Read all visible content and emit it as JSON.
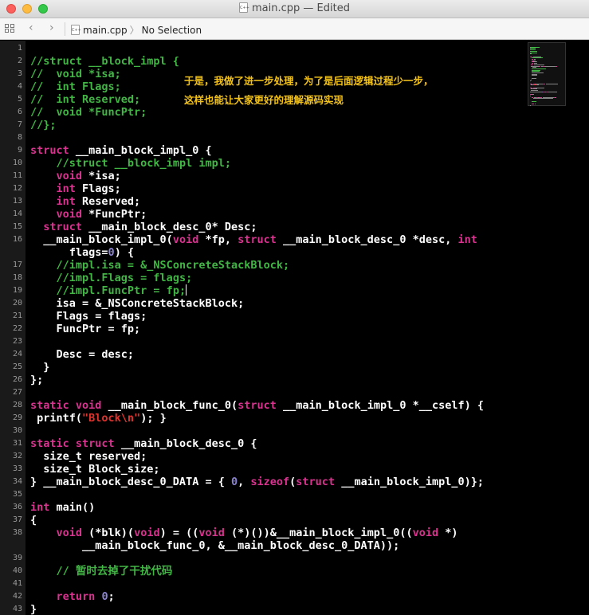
{
  "window": {
    "title": "main.cpp — Edited",
    "colors": {
      "close": "#fc605c",
      "minimize": "#fdbc40",
      "maximize": "#34c84a"
    }
  },
  "navbar": {
    "breadcrumb_file": "main.cpp",
    "breadcrumb_separator": "〉",
    "breadcrumb_selection": "No Selection",
    "back_icon": "‹",
    "forward_icon": "›"
  },
  "annotations": {
    "line1": "于是，我做了进一步处理，为了是后面逻辑过程少一步，",
    "line2": "这样也能让大家更好的理解源码实现"
  },
  "syntax_colors": {
    "comment": "#41b645",
    "keyword": "#d7338f",
    "string": "#e0332e",
    "number": "#8b84cf",
    "plain": "#ffffff"
  },
  "code_lines": [
    {
      "n": "1",
      "tokens": []
    },
    {
      "n": "2",
      "tokens": [
        [
          "c",
          "//struct __block_impl {"
        ]
      ]
    },
    {
      "n": "3",
      "tokens": [
        [
          "c",
          "//  void *isa;"
        ]
      ]
    },
    {
      "n": "4",
      "tokens": [
        [
          "c",
          "//  int Flags;"
        ]
      ]
    },
    {
      "n": "5",
      "tokens": [
        [
          "c",
          "//  int Reserved;"
        ]
      ]
    },
    {
      "n": "6",
      "tokens": [
        [
          "c",
          "//  void *FuncPtr;"
        ]
      ]
    },
    {
      "n": "7",
      "tokens": [
        [
          "c",
          "//};"
        ]
      ]
    },
    {
      "n": "8",
      "tokens": []
    },
    {
      "n": "9",
      "tokens": [
        [
          "k",
          "struct"
        ],
        [
          "p",
          " __main_block_impl_0 {"
        ]
      ]
    },
    {
      "n": "10",
      "tokens": [
        [
          "p",
          "    "
        ],
        [
          "c",
          "//struct __block_impl impl;"
        ]
      ]
    },
    {
      "n": "11",
      "tokens": [
        [
          "p",
          "    "
        ],
        [
          "k",
          "void"
        ],
        [
          "p",
          " *isa;"
        ]
      ]
    },
    {
      "n": "12",
      "tokens": [
        [
          "p",
          "    "
        ],
        [
          "k",
          "int"
        ],
        [
          "p",
          " Flags;"
        ]
      ]
    },
    {
      "n": "13",
      "tokens": [
        [
          "p",
          "    "
        ],
        [
          "k",
          "int"
        ],
        [
          "p",
          " Reserved;"
        ]
      ]
    },
    {
      "n": "14",
      "tokens": [
        [
          "p",
          "    "
        ],
        [
          "k",
          "void"
        ],
        [
          "p",
          " *FuncPtr;"
        ]
      ]
    },
    {
      "n": "15",
      "tokens": [
        [
          "p",
          "  "
        ],
        [
          "k",
          "struct"
        ],
        [
          "p",
          " __main_block_desc_0* Desc;"
        ]
      ]
    },
    {
      "n": "16",
      "tokens": [
        [
          "p",
          "  __main_block_impl_0("
        ],
        [
          "k",
          "void"
        ],
        [
          "p",
          " *fp, "
        ],
        [
          "k",
          "struct"
        ],
        [
          "p",
          " __main_block_desc_0 *desc, "
        ],
        [
          "k",
          "int"
        ]
      ]
    },
    {
      "n": "",
      "tokens": [
        [
          "p",
          "      flags="
        ],
        [
          "n",
          "0"
        ],
        [
          "p",
          ") {"
        ]
      ]
    },
    {
      "n": "17",
      "tokens": [
        [
          "p",
          "    "
        ],
        [
          "c",
          "//impl.isa = &_NSConcreteStackBlock;"
        ]
      ]
    },
    {
      "n": "18",
      "tokens": [
        [
          "p",
          "    "
        ],
        [
          "c",
          "//impl.Flags = flags;"
        ]
      ]
    },
    {
      "n": "19",
      "tokens": [
        [
          "p",
          "    "
        ],
        [
          "c",
          "//impl.FuncPtr = fp;"
        ],
        [
          "cur",
          ""
        ]
      ]
    },
    {
      "n": "20",
      "tokens": [
        [
          "p",
          "    isa = &_NSConcreteStackBlock;"
        ]
      ]
    },
    {
      "n": "21",
      "tokens": [
        [
          "p",
          "    Flags = flags;"
        ]
      ]
    },
    {
      "n": "22",
      "tokens": [
        [
          "p",
          "    FuncPtr = fp;"
        ]
      ]
    },
    {
      "n": "23",
      "tokens": []
    },
    {
      "n": "24",
      "tokens": [
        [
          "p",
          "    Desc = desc;"
        ]
      ]
    },
    {
      "n": "25",
      "tokens": [
        [
          "p",
          "  }"
        ]
      ]
    },
    {
      "n": "26",
      "tokens": [
        [
          "p",
          "};"
        ]
      ]
    },
    {
      "n": "27",
      "tokens": []
    },
    {
      "n": "28",
      "tokens": [
        [
          "k",
          "static"
        ],
        [
          "p",
          " "
        ],
        [
          "k",
          "void"
        ],
        [
          "p",
          " __main_block_func_0("
        ],
        [
          "k",
          "struct"
        ],
        [
          "p",
          " __main_block_impl_0 *__cself) {"
        ]
      ]
    },
    {
      "n": "29",
      "tokens": [
        [
          "p",
          " printf("
        ],
        [
          "s",
          "\"Block\\n\""
        ],
        [
          "p",
          "); }"
        ]
      ]
    },
    {
      "n": "30",
      "tokens": []
    },
    {
      "n": "31",
      "tokens": [
        [
          "k",
          "static"
        ],
        [
          "p",
          " "
        ],
        [
          "k",
          "struct"
        ],
        [
          "p",
          " __main_block_desc_0 {"
        ]
      ]
    },
    {
      "n": "32",
      "tokens": [
        [
          "p",
          "  size_t reserved;"
        ]
      ]
    },
    {
      "n": "33",
      "tokens": [
        [
          "p",
          "  size_t Block_size;"
        ]
      ]
    },
    {
      "n": "34",
      "tokens": [
        [
          "p",
          "} __main_block_desc_0_DATA = { "
        ],
        [
          "n",
          "0"
        ],
        [
          "p",
          ", "
        ],
        [
          "k",
          "sizeof"
        ],
        [
          "p",
          "("
        ],
        [
          "k",
          "struct"
        ],
        [
          "p",
          " __main_block_impl_0)};"
        ]
      ]
    },
    {
      "n": "35",
      "tokens": []
    },
    {
      "n": "36",
      "tokens": [
        [
          "k",
          "int"
        ],
        [
          "p",
          " main()"
        ]
      ]
    },
    {
      "n": "37",
      "tokens": [
        [
          "p",
          "{"
        ]
      ]
    },
    {
      "n": "38",
      "tokens": [
        [
          "p",
          "    "
        ],
        [
          "k",
          "void"
        ],
        [
          "p",
          " (*blk)("
        ],
        [
          "k",
          "void"
        ],
        [
          "p",
          ") = (("
        ],
        [
          "k",
          "void"
        ],
        [
          "p",
          " (*)())&__main_block_impl_0(("
        ],
        [
          "k",
          "void"
        ],
        [
          "p",
          " *)"
        ]
      ]
    },
    {
      "n": "",
      "tokens": [
        [
          "p",
          "        __main_block_func_0, &__main_block_desc_0_DATA));"
        ]
      ]
    },
    {
      "n": "39",
      "tokens": []
    },
    {
      "n": "40",
      "tokens": [
        [
          "p",
          "    "
        ],
        [
          "c",
          "// 暂时去掉了干扰代码"
        ]
      ]
    },
    {
      "n": "41",
      "tokens": []
    },
    {
      "n": "42",
      "tokens": [
        [
          "p",
          "    "
        ],
        [
          "k",
          "return"
        ],
        [
          "p",
          " "
        ],
        [
          "n",
          "0"
        ],
        [
          "p",
          ";"
        ]
      ]
    },
    {
      "n": "43",
      "tokens": [
        [
          "p",
          "}"
        ]
      ]
    }
  ]
}
